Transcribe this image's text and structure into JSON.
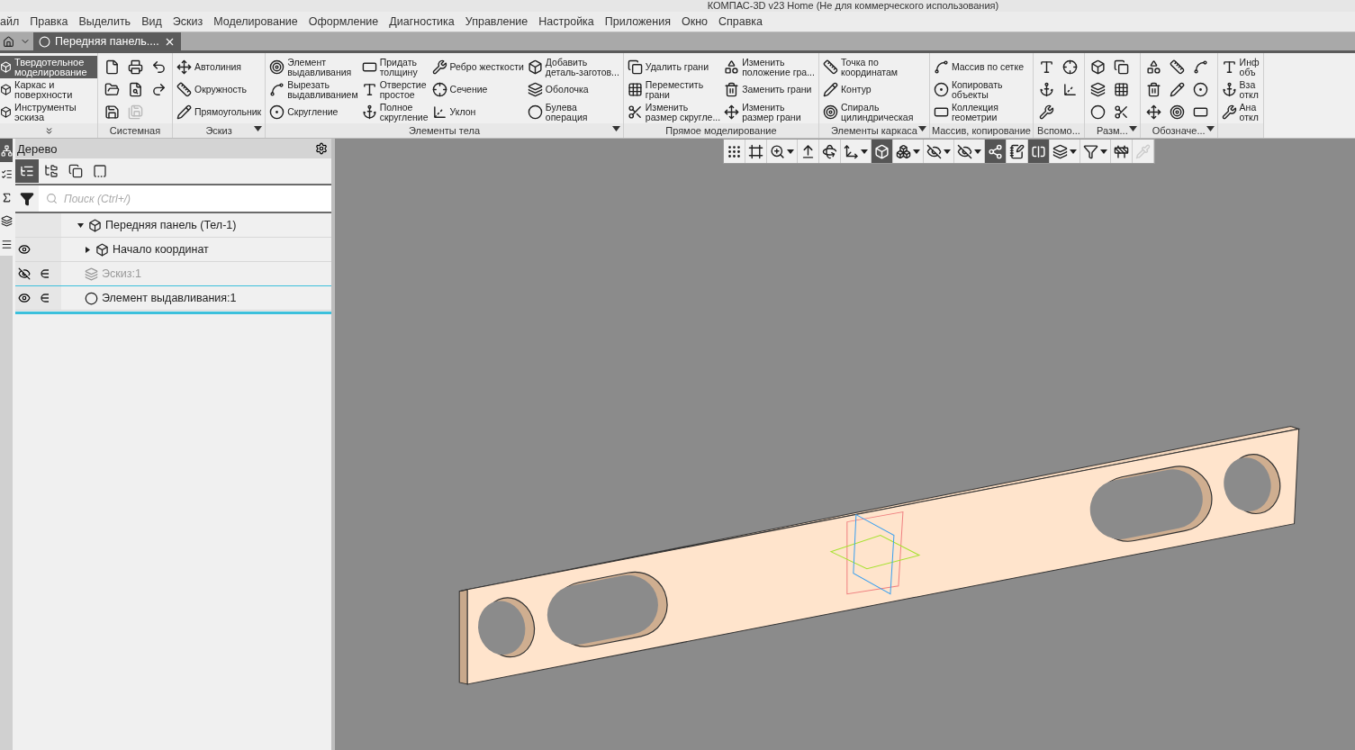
{
  "window": {
    "title": "КОМПАС-3D v23 Home (Не для коммерческого использования)"
  },
  "menu": [
    "айл",
    "Правка",
    "Выделить",
    "Вид",
    "Эскиз",
    "Моделирование",
    "Оформление",
    "Диагностика",
    "Управление",
    "Настройка",
    "Приложения",
    "Окно",
    "Справка"
  ],
  "document_tabs": [
    {
      "label": "Передняя панель....",
      "selected": true
    }
  ],
  "ribbon": {
    "modes": [
      {
        "lines": [
          "Твердотельное",
          "моделирование"
        ],
        "selected": true
      },
      {
        "lines": [
          "Каркас и",
          "поверхности"
        ],
        "selected": false
      },
      {
        "lines": [
          "Инструменты",
          "эскиза"
        ],
        "selected": false
      }
    ],
    "groups": [
      {
        "label": "Системная",
        "has_menu": false,
        "columns": [
          [
            {
              "kind": "icon",
              "disabled": false
            },
            {
              "kind": "icon",
              "disabled": false
            },
            {
              "kind": "icon",
              "disabled": false
            }
          ],
          [
            {
              "kind": "icon",
              "disabled": false
            },
            {
              "kind": "icon",
              "disabled": false
            },
            {
              "kind": "icon",
              "disabled": true
            }
          ],
          [
            {
              "kind": "icon",
              "disabled": false
            },
            {
              "kind": "icon",
              "disabled": false
            }
          ]
        ]
      },
      {
        "label": "Эскиз",
        "has_menu": true,
        "columns": [
          [
            {
              "kind": "command",
              "lines": [
                "Автолиния"
              ]
            },
            {
              "kind": "command",
              "lines": [
                "Окружность"
              ]
            },
            {
              "kind": "command",
              "lines": [
                "Прямоугольник"
              ]
            }
          ]
        ]
      },
      {
        "label": "Элементы тела",
        "has_menu": true,
        "columns": [
          [
            {
              "kind": "command",
              "lines": [
                "Элемент",
                "выдавливания"
              ]
            },
            {
              "kind": "command",
              "lines": [
                "Вырезать",
                "выдавливанием"
              ]
            },
            {
              "kind": "command",
              "lines": [
                "Скругление"
              ]
            }
          ],
          [
            {
              "kind": "command",
              "lines": [
                "Придать",
                "толщину"
              ]
            },
            {
              "kind": "command",
              "lines": [
                "Отверстие",
                "простое"
              ]
            },
            {
              "kind": "command",
              "lines": [
                "Полное",
                "скругление"
              ]
            }
          ],
          [
            {
              "kind": "command",
              "lines": [
                "Ребро жесткости"
              ]
            },
            {
              "kind": "command",
              "lines": [
                "Сечение"
              ]
            },
            {
              "kind": "command",
              "lines": [
                "Уклон"
              ]
            }
          ],
          [
            {
              "kind": "command",
              "lines": [
                "Добавить",
                "деталь-заготов..."
              ]
            },
            {
              "kind": "command",
              "lines": [
                "Оболочка"
              ]
            },
            {
              "kind": "command",
              "lines": [
                "Булева",
                "операция"
              ]
            }
          ]
        ]
      },
      {
        "label": "Прямое моделирование",
        "has_menu": false,
        "columns": [
          [
            {
              "kind": "command",
              "lines": [
                "Удалить грани"
              ]
            },
            {
              "kind": "command",
              "lines": [
                "Переместить",
                "грани"
              ]
            },
            {
              "kind": "command",
              "lines": [
                "Изменить",
                "размер скругле..."
              ]
            }
          ],
          [
            {
              "kind": "command",
              "lines": [
                "Изменить",
                "положение гра..."
              ]
            },
            {
              "kind": "command",
              "lines": [
                "Заменить грани"
              ]
            },
            {
              "kind": "command",
              "lines": [
                "Изменить",
                "размер грани"
              ]
            }
          ]
        ]
      },
      {
        "label": "Элементы каркаса",
        "has_menu": true,
        "columns": [
          [
            {
              "kind": "command",
              "lines": [
                "Точка по",
                "координатам"
              ]
            },
            {
              "kind": "command",
              "lines": [
                "Контур"
              ]
            },
            {
              "kind": "command",
              "lines": [
                "Спираль",
                "цилиндрическая"
              ]
            }
          ]
        ]
      },
      {
        "label": "Массив, копирование",
        "has_menu": false,
        "columns": [
          [
            {
              "kind": "command",
              "lines": [
                "Массив по сетке"
              ]
            },
            {
              "kind": "command",
              "lines": [
                "Копировать",
                "объекты"
              ]
            },
            {
              "kind": "command",
              "lines": [
                "Коллекция",
                "геометрии"
              ]
            }
          ]
        ]
      },
      {
        "label": "Вспомо...",
        "has_menu": false,
        "columns": [
          [
            {
              "kind": "icon",
              "disabled": false
            },
            {
              "kind": "icon",
              "disabled": false
            },
            {
              "kind": "icon",
              "disabled": false
            }
          ],
          [
            {
              "kind": "icon",
              "disabled": false
            },
            {
              "kind": "icon",
              "disabled": false
            }
          ]
        ]
      },
      {
        "label": "Разм...",
        "has_menu": true,
        "columns": [
          [
            {
              "kind": "icon",
              "disabled": false
            },
            {
              "kind": "icon",
              "disabled": false
            },
            {
              "kind": "icon",
              "disabled": false
            }
          ],
          [
            {
              "kind": "icon",
              "disabled": false
            },
            {
              "kind": "icon",
              "disabled": false
            },
            {
              "kind": "icon",
              "disabled": false
            }
          ]
        ]
      },
      {
        "label": "Обозначе...",
        "has_menu": true,
        "columns": [
          [
            {
              "kind": "icon",
              "disabled": false
            },
            {
              "kind": "icon",
              "disabled": false
            },
            {
              "kind": "icon",
              "disabled": false
            }
          ],
          [
            {
              "kind": "icon",
              "disabled": false
            },
            {
              "kind": "icon",
              "disabled": false
            },
            {
              "kind": "icon",
              "disabled": false
            }
          ],
          [
            {
              "kind": "icon",
              "disabled": false
            },
            {
              "kind": "icon",
              "disabled": false
            },
            {
              "kind": "icon",
              "disabled": false
            }
          ]
        ]
      },
      {
        "columns": [
          [
            {
              "kind": "command",
              "lines": [
                "Инф",
                "объ"
              ]
            },
            {
              "kind": "command",
              "lines": [
                "Вза",
                "откл"
              ]
            },
            {
              "kind": "command",
              "lines": [
                "Ана",
                "откл"
              ]
            }
          ]
        ]
      }
    ]
  },
  "side_strip": [
    {
      "selected": true
    },
    {
      "selected": false
    },
    {
      "selected": false
    },
    {
      "selected": false
    },
    {
      "selected": false
    }
  ],
  "tree_panel": {
    "title": "Дерево",
    "view_buttons": [
      {
        "selected": true
      },
      {
        "selected": false
      },
      {
        "selected": false
      },
      {
        "selected": false
      }
    ],
    "search": {
      "placeholder": "Поиск (Ctrl+/)"
    },
    "items": [
      {
        "label": "Передняя панель (Тел-1)",
        "expanded": true,
        "children": [
          {
            "label": "Начало координат",
            "expanded": false,
            "visible": true,
            "linked": false
          },
          {
            "label": "Эскиз:1",
            "visible": false,
            "linked": true
          },
          {
            "label": "Элемент выдавливания:1",
            "visible": true,
            "linked": true
          }
        ]
      }
    ]
  },
  "view_toolbar": [
    {
      "selected": false,
      "dropdown": false,
      "disabled": false
    },
    {
      "selected": false,
      "dropdown": false,
      "disabled": false
    },
    {
      "selected": false,
      "dropdown": true,
      "disabled": false
    },
    {
      "selected": false,
      "dropdown": false,
      "disabled": false
    },
    {
      "selected": false,
      "dropdown": false,
      "disabled": false
    },
    {
      "selected": false,
      "dropdown": true,
      "disabled": false
    },
    {
      "selected": true,
      "dropdown": false,
      "disabled": false
    },
    {
      "selected": false,
      "dropdown": true,
      "disabled": false
    },
    {
      "selected": false,
      "dropdown": true,
      "disabled": false
    },
    {
      "selected": false,
      "dropdown": true,
      "disabled": false
    },
    {
      "selected": true,
      "dropdown": false,
      "disabled": false
    },
    {
      "selected": false,
      "dropdown": false,
      "disabled": false
    },
    {
      "selected": true,
      "dropdown": false,
      "disabled": false
    },
    {
      "selected": false,
      "dropdown": true,
      "disabled": false
    },
    {
      "selected": false,
      "dropdown": true,
      "disabled": false
    },
    {
      "selected": false,
      "dropdown": false,
      "disabled": false
    },
    {
      "selected": false,
      "dropdown": false,
      "disabled": true
    }
  ]
}
